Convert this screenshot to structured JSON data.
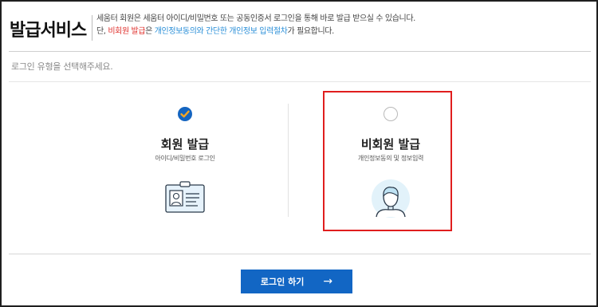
{
  "header": {
    "title": "발급서비스",
    "desc_line1": "세움터 회원은 세움터 아이디/비밀번호 또는 공동인증서 로그인을 통해 바로 발급 받으실 수 있습니다.",
    "desc_line2": {
      "prefix": "단, ",
      "guest_issue": "비회원 발급",
      "middle": "은 ",
      "steps": "개인정보동의와 간단한 개인정보 입력절차",
      "suffix": "가 필요합니다."
    }
  },
  "prompt": "로그인 유형을 선택해주세요.",
  "options": [
    {
      "title": "회원 발급",
      "subtitle": "아이디/비밀번호 로그인",
      "selected": true,
      "icon": "id-card-icon"
    },
    {
      "title": "비회원 발급",
      "subtitle": "개인정보동의 및 정보입력",
      "selected": false,
      "icon": "person-avatar-icon"
    }
  ],
  "login_button": {
    "label": "로그인 하기",
    "arrow": "→"
  },
  "colors": {
    "accent": "#1266c4",
    "highlight": "#e0322e",
    "link": "#2a8fd8",
    "selection_outline": "#e01e1e"
  }
}
